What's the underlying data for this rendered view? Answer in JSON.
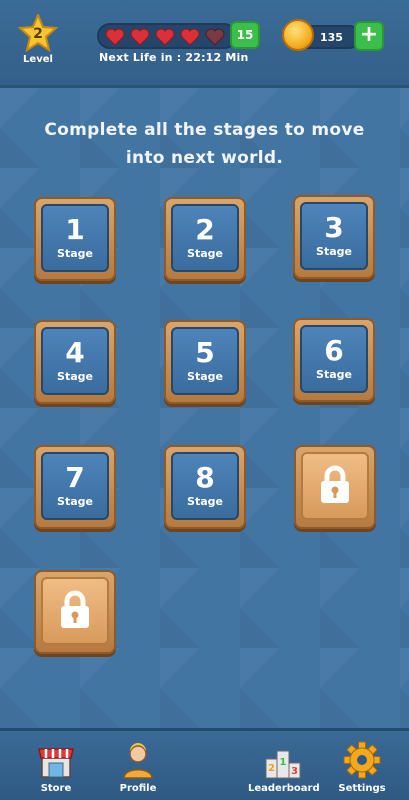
{
  "header": {
    "level_number": "2",
    "level_label": "Level",
    "lives_count": "15",
    "hearts_total": 5,
    "hearts_filled": 4,
    "next_life_text": "Next   Life in : 22:12 Min",
    "coins": "135",
    "add_label": "+"
  },
  "heading": {
    "line1": "Complete all the stages to move",
    "line2": "into next world."
  },
  "stages": [
    {
      "number": "1",
      "label": "Stage",
      "locked": false
    },
    {
      "number": "2",
      "label": "Stage",
      "locked": false
    },
    {
      "number": "3",
      "label": "Stage",
      "locked": false
    },
    {
      "number": "4",
      "label": "Stage",
      "locked": false
    },
    {
      "number": "5",
      "label": "Stage",
      "locked": false
    },
    {
      "number": "6",
      "label": "Stage",
      "locked": false
    },
    {
      "number": "7",
      "label": "Stage",
      "locked": false
    },
    {
      "number": "8",
      "label": "Stage",
      "locked": false
    },
    {
      "locked": true,
      "icon": "lock-icon"
    },
    {
      "locked": true,
      "icon": "lock-icon"
    }
  ],
  "nav": {
    "store": "Store",
    "profile": "Profile",
    "leaderboard": "Leaderboard",
    "settings": "Settings"
  },
  "colors": {
    "background": "#4375a3",
    "tile_frame": "#c98d52",
    "tile_face": "#4279ad",
    "accent_green": "#3bbf4a",
    "heart_red": "#d9303a"
  }
}
